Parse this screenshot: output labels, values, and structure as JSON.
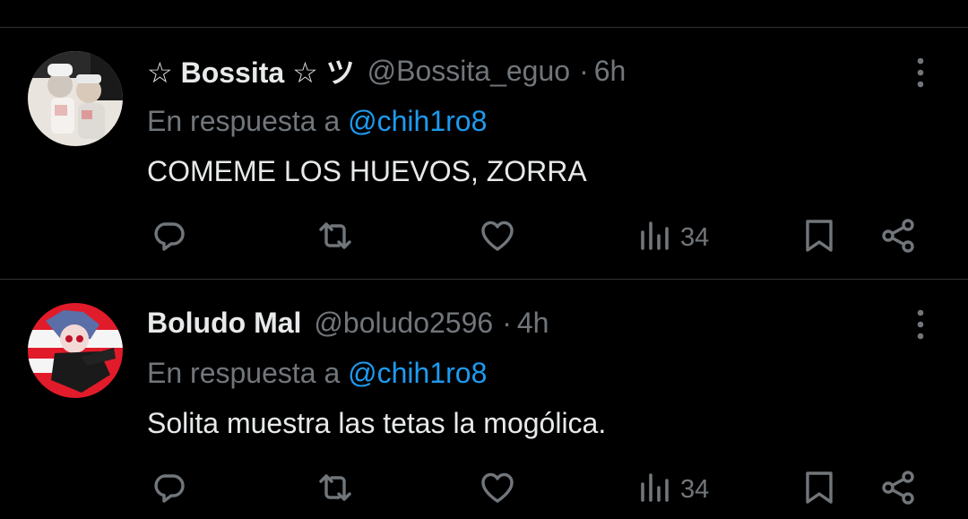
{
  "tweets": [
    {
      "display_name": "☆ Bossita ☆ ツ",
      "handle": "@Bossita_eguo",
      "separator": "·",
      "time": "6h",
      "reply_prefix": "En respuesta a",
      "reply_mention": "@chih1ro8",
      "text": "COMEME LOS HUEVOS, ZORRA",
      "views": "34",
      "icons": [
        "reply-icon",
        "retweet-icon",
        "like-icon",
        "views-icon",
        "bookmark-icon",
        "share-icon",
        "more-icon"
      ]
    },
    {
      "display_name": "Boludo Mal",
      "handle": "@boludo2596",
      "separator": "·",
      "time": "4h",
      "reply_prefix": "En respuesta a",
      "reply_mention": "@chih1ro8",
      "text": "Solita muestra las tetas la mogólica.",
      "views": "34",
      "icons": [
        "reply-icon",
        "retweet-icon",
        "like-icon",
        "views-icon",
        "bookmark-icon",
        "share-icon",
        "more-icon"
      ]
    }
  ],
  "colors": {
    "background": "#000000",
    "text": "#e7e9ea",
    "muted": "#71767b",
    "link": "#1d9bf0",
    "divider": "#2f3336"
  }
}
